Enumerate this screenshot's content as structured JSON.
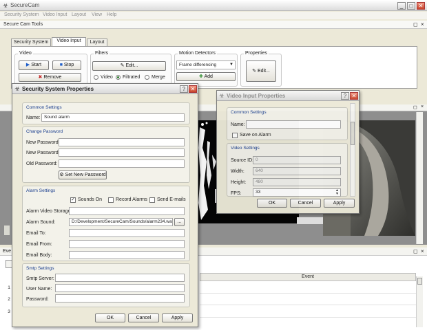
{
  "app": {
    "title": "SecureCam"
  },
  "menu": [
    "Security System",
    "Video Input",
    "Layout",
    "View",
    "Help"
  ],
  "panel": {
    "title": "Secure Cam Tools"
  },
  "tabs": [
    "Security System",
    "Video Input",
    "Layout"
  ],
  "ribbon": {
    "video": {
      "title": "Video",
      "start": "Start",
      "stop": "Stop",
      "remove": "Remove"
    },
    "filters": {
      "title": "Filters",
      "edit": "Edit...",
      "opt_video": "Video",
      "opt_filtrated": "Filtrated",
      "opt_merge": "Merge"
    },
    "motion": {
      "title": "Motion Detectors",
      "selected": "Frame differencing",
      "add": "Add"
    },
    "properties": {
      "title": "Properties",
      "edit": "Edit..."
    }
  },
  "security_dialog": {
    "title": "Security System Properties",
    "common": {
      "title": "Common Settings",
      "name_label": "Name:",
      "name_value": "Sound alarm"
    },
    "password": {
      "title": "Change Password",
      "new1": "New Password:",
      "new2": "New Password:",
      "old": "Old Password:",
      "set_button": "Set New Password"
    },
    "alarm": {
      "title": "Alarm Settings",
      "sounds_on": "Sounds On",
      "record_alarms": "Record Alarms",
      "send_emails": "Send E-mails",
      "video_storage": "Alarm Video Storage:",
      "sound": "Alarm Sound:",
      "sound_value": "D:/Development/SecureCam/Sounds/alarm234.wav",
      "browse": "...",
      "email_to": "Email To:",
      "email_from": "Email From:",
      "email_body": "Email Body:"
    },
    "smtp": {
      "title": "Smtp Settings",
      "server": "Smtp Server:",
      "user": "User Name:",
      "password": "Password:"
    },
    "ok": "OK",
    "cancel": "Cancel",
    "apply": "Apply"
  },
  "video_dialog": {
    "title": "Video Input Properties",
    "common": {
      "title": "Common Settings",
      "name_label": "Name:",
      "save_on_alarm": "Save on Alarm"
    },
    "video": {
      "title": "Video Settings",
      "source_id": "Source ID:",
      "source_id_value": "0",
      "width": "Width:",
      "width_value": "640",
      "height": "Height:",
      "height_value": "480",
      "fps": "FPS:",
      "fps_value": "33"
    },
    "ok": "OK",
    "cancel": "Cancel",
    "apply": "Apply"
  },
  "events": {
    "title": "Eve",
    "column": "Event",
    "rows": [
      "1",
      "2",
      "3"
    ]
  }
}
